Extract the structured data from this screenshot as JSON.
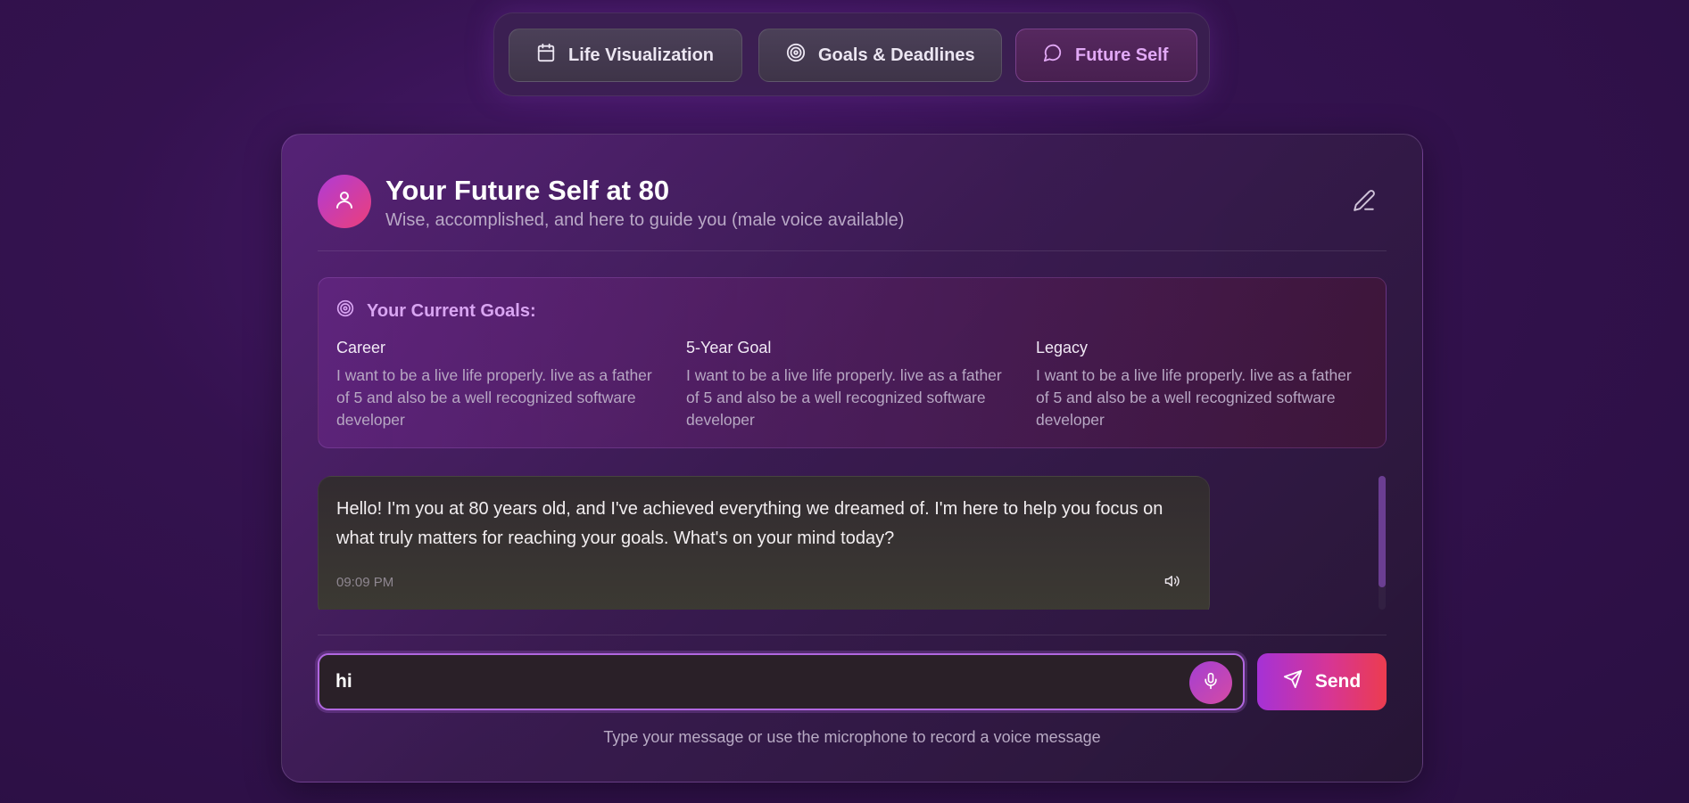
{
  "nav": {
    "tabs": [
      {
        "label": "Life Visualization",
        "icon": "calendar-icon",
        "active": false
      },
      {
        "label": "Goals & Deadlines",
        "icon": "target-icon",
        "active": false
      },
      {
        "label": "Future Self",
        "icon": "chat-bubble-icon",
        "active": true
      }
    ]
  },
  "header": {
    "title": "Your Future Self at 80",
    "subtitle": "Wise, accomplished, and here to guide you (male voice available)",
    "avatar_icon": "user-icon",
    "edit_icon": "pencil-icon"
  },
  "goals": {
    "heading": "Your Current Goals:",
    "items": [
      {
        "label": "Career",
        "text": "I want to be a live life properly. live as a father of 5 and also be a well recognized software developer"
      },
      {
        "label": "5-Year Goal",
        "text": "I want to be a live life properly. live as a father of 5 and also be a well recognized software developer"
      },
      {
        "label": "Legacy",
        "text": "I want to be a live life properly. live as a father of 5 and also be a well recognized software developer"
      }
    ]
  },
  "chat": {
    "messages": [
      {
        "text": "Hello! I'm you at 80 years old, and I've achieved everything we dreamed of. I'm here to help you focus on what truly matters for reaching your goals. What's on your mind today?",
        "time": "09:09 PM"
      }
    ]
  },
  "composer": {
    "value": "hi",
    "send_label": "Send",
    "hint": "Type your message or use the microphone to record a voice message"
  },
  "colors": {
    "accent_purple": "#a532d6",
    "accent_pink": "#ec3c4f",
    "active_tab_text": "#e2a9f6"
  }
}
